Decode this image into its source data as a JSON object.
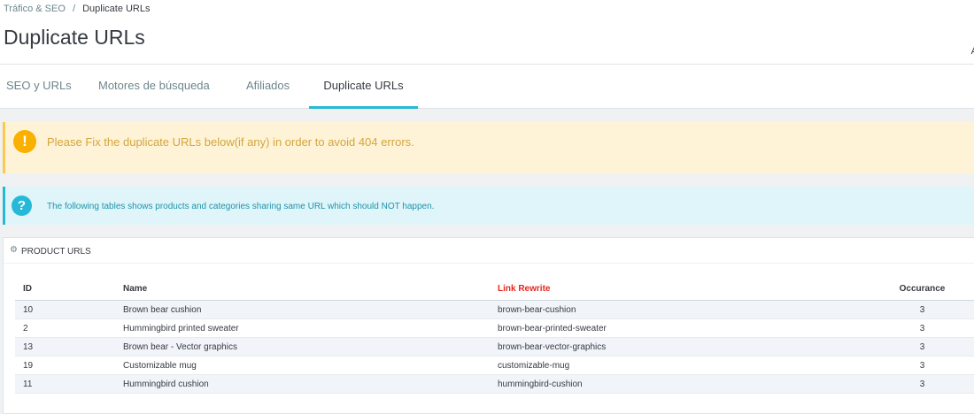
{
  "breadcrumb": {
    "parent": "Tráfico & SEO",
    "separator": "/",
    "current": "Duplicate URLs"
  },
  "page_title": "Duplicate URLs",
  "header_right_text": "A",
  "tabs": [
    {
      "label": "SEO y URLs",
      "active": false
    },
    {
      "label": "Motores de búsqueda",
      "active": false
    },
    {
      "label": "Afiliados",
      "active": false
    },
    {
      "label": "Duplicate URLs",
      "active": true
    }
  ],
  "alerts": {
    "warning": {
      "icon": "!",
      "text": "Please Fix the duplicate URLs below(if any) in order to avoid 404 errors."
    },
    "info": {
      "icon": "?",
      "text": "The following tables shows products and categories sharing same URL which should NOT happen."
    }
  },
  "panel": {
    "icon": "cogs-icon",
    "title": "PRODUCT URLS",
    "columns": [
      "ID",
      "Name",
      "Link Rewrite",
      "Occurance"
    ],
    "rows": [
      {
        "id": "10",
        "name": "Brown bear cushion",
        "link_rewrite": "brown-bear-cushion",
        "occurance": "3"
      },
      {
        "id": "2",
        "name": "Hummingbird printed sweater",
        "link_rewrite": "brown-bear-printed-sweater",
        "occurance": "3"
      },
      {
        "id": "13",
        "name": "Brown bear - Vector graphics",
        "link_rewrite": "brown-bear-vector-graphics",
        "occurance": "3"
      },
      {
        "id": "19",
        "name": "Customizable mug",
        "link_rewrite": "customizable-mug",
        "occurance": "3"
      },
      {
        "id": "11",
        "name": "Hummingbird cushion",
        "link_rewrite": "hummingbird-cushion",
        "occurance": "3"
      }
    ]
  },
  "colors": {
    "accent": "#25b9d7",
    "warning_bg": "#fff3d7",
    "warning_icon": "#fab000",
    "info_bg": "#dff5f9",
    "link_rewrite_header": "#e5261d"
  }
}
